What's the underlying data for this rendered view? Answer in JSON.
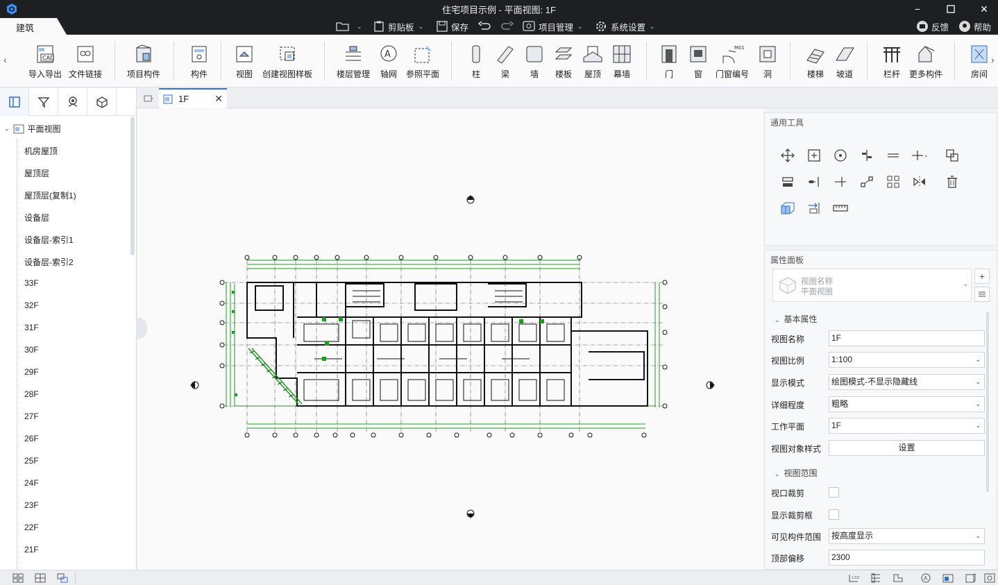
{
  "window": {
    "title": "住宅项目示例 - 平面视图: 1F",
    "minimize": "−",
    "maximize": "☐",
    "close": "✕"
  },
  "app_tab": "建筑",
  "quick_toolbar": {
    "clipboard": "剪贴板",
    "save": "保存",
    "project_management": "项目管理",
    "system_settings": "系统设置",
    "feedback": "反馈",
    "help": "帮助"
  },
  "ribbon": {
    "import_export": "导入导出",
    "file_link": "文件链接",
    "project_component": "项目构件",
    "component": "构件",
    "view": "视图",
    "create_view_template": "创建视图样板",
    "floor_management": "楼层管理",
    "axis_grid": "轴网",
    "reference_plane": "参照平面",
    "column": "柱",
    "beam": "梁",
    "wall": "墙",
    "floor_slab": "楼板",
    "roof": "屋顶",
    "curtain_wall": "幕墙",
    "door": "门",
    "window": "窗",
    "door_window_numbering": "门窗编号",
    "opening": "洞",
    "stairs": "楼梯",
    "ramp": "坡道",
    "railing": "栏杆",
    "more_components": "更多构件",
    "room": "房间",
    "m01_tag": "M01"
  },
  "tree": {
    "root": "平面视图",
    "items": [
      "机房屋顶",
      "屋顶层",
      "屋顶层(复制1)",
      "设备层",
      "设备层-索引1",
      "设备层-索引2",
      "33F",
      "32F",
      "31F",
      "30F",
      "29F",
      "28F",
      "27F",
      "26F",
      "25F",
      "24F",
      "23F",
      "22F",
      "21F"
    ]
  },
  "doc_tab": {
    "label": "1F",
    "close": "✕"
  },
  "tools_panel": {
    "title": "通用工具"
  },
  "props": {
    "title": "属性面板",
    "view_selector": {
      "line1": "视图名称",
      "line2": "平面视图"
    },
    "add": "+",
    "section_basic": "基本属性",
    "view_name_label": "视图名称",
    "view_name_value": "1F",
    "scale_label": "视图比例",
    "scale_value": "1:100",
    "display_mode_label": "显示模式",
    "display_mode_value": "绘图模式-不显示隐藏线",
    "detail_label": "详细程度",
    "detail_value": "粗略",
    "work_plane_label": "工作平面",
    "work_plane_value": "1F",
    "object_style_label": "视图对象样式",
    "object_style_button": "设置",
    "section_range": "视图范围",
    "viewport_crop_label": "视口裁剪",
    "show_crop_label": "显示裁剪框",
    "visible_range_label": "可见构件范围",
    "visible_range_value": "按高度显示",
    "top_offset_label": "顶部偏移",
    "top_offset_value": "2300"
  },
  "colors": {
    "accent": "#2f6fd6",
    "titlebar": "#1e1f22",
    "plan_green": "#16a016",
    "plan_black": "#111111"
  }
}
